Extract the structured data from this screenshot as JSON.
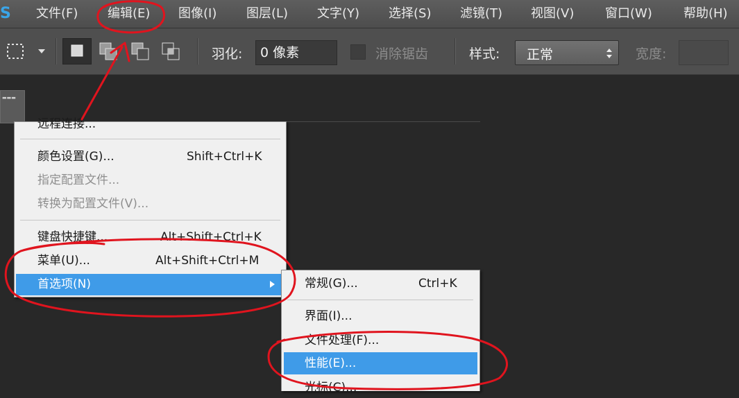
{
  "app_logo": "S",
  "menubar": {
    "items": [
      "文件(F)",
      "编辑(E)",
      "图像(I)",
      "图层(L)",
      "文字(Y)",
      "选择(S)",
      "滤镜(T)",
      "视图(V)",
      "窗口(W)",
      "帮助(H)"
    ]
  },
  "options_bar": {
    "feather_label": "羽化:",
    "feather_value": "0 像素",
    "antialias_label": "消除锯齿",
    "style_label": "样式:",
    "style_value": "正常",
    "width_label": "宽度:"
  },
  "edit_menu": {
    "partial_item": "远程连接...",
    "items": [
      {
        "label": "颜色设置(G)...",
        "shortcut": "Shift+Ctrl+K",
        "enabled": true
      },
      {
        "label": "指定配置文件...",
        "shortcut": "",
        "enabled": false
      },
      {
        "label": "转换为配置文件(V)...",
        "shortcut": "",
        "enabled": false
      },
      {
        "label": "键盘快捷键...",
        "shortcut": "Alt+Shift+Ctrl+K",
        "enabled": true
      },
      {
        "label": "菜单(U)...",
        "shortcut": "Alt+Shift+Ctrl+M",
        "enabled": true
      },
      {
        "label": "首选项(N)",
        "shortcut": "",
        "enabled": true,
        "highlighted": true,
        "submenu": true
      }
    ]
  },
  "preferences_submenu": {
    "items": [
      {
        "label": "常规(G)...",
        "shortcut": "Ctrl+K"
      },
      {
        "label": "界面(I)..."
      },
      {
        "label": "文件处理(F)..."
      },
      {
        "label": "性能(E)...",
        "highlighted": true
      },
      {
        "label": "光标(C)..."
      }
    ]
  },
  "colors": {
    "menu_highlight": "#3f9be8",
    "annotation": "#e0141e",
    "menubar": "#555555",
    "workspace": "#282828"
  }
}
